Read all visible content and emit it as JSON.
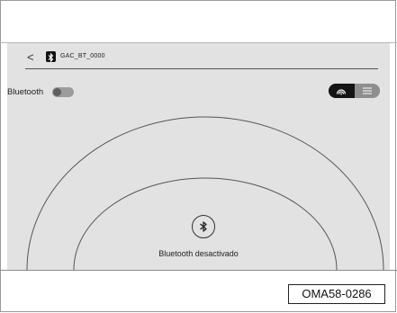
{
  "header": {
    "back_label": "<",
    "device_name": "GAC_BT_0000"
  },
  "bluetooth": {
    "label": "Bluetooth",
    "enabled": false,
    "status_text": "Bluetooth desactivado"
  },
  "view_switch": {
    "active": "discovery",
    "options": [
      "discovery-icon",
      "list-icon"
    ]
  },
  "figure_code": "OMA58-0286",
  "colors": {
    "screen_bg": "#e2e2e2",
    "toggle_off": "#9c9c9c",
    "segment_active": "#141414"
  }
}
